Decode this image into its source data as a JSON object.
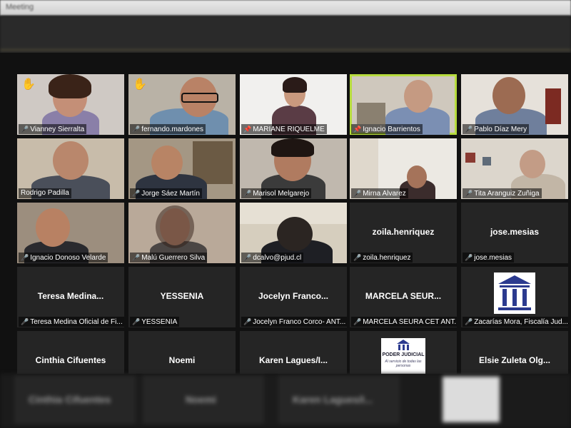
{
  "window": {
    "title": "Meeting"
  },
  "participants": [
    {
      "label": "Vianney Sierralta",
      "hand": true,
      "status": "muted"
    },
    {
      "label": "fernando.mardones",
      "hand": true,
      "status": "muted"
    },
    {
      "label": "MARIANE RIQUELME",
      "status": "pinned"
    },
    {
      "label": "Ignacio Barrientos",
      "status": "pinned",
      "active": true
    },
    {
      "label": "Pablo Díaz Mery",
      "status": "muted"
    },
    {
      "label": "Rodrigo Padilla",
      "status": "none"
    },
    {
      "label": "Jorge Sáez Martín",
      "status": "muted"
    },
    {
      "label": "Marisol Melgarejo",
      "status": "muted"
    },
    {
      "label": "Mirna Alvarez",
      "status": "muted"
    },
    {
      "label": "Tita Aranguiz Zuñiga",
      "status": "muted"
    },
    {
      "label": "Ignacio Donoso Velarde",
      "status": "muted"
    },
    {
      "label": "Malú Guerrero Silva",
      "status": "muted"
    },
    {
      "label": "dcalvo@pjud.cl",
      "status": "muted"
    },
    {
      "label": "zoila.henriquez",
      "display": "zoila.henriquez",
      "status": "muted"
    },
    {
      "label": "jose.mesias",
      "display": "jose.mesias",
      "status": "muted"
    },
    {
      "label": "Teresa Medina Oficial de Fi...",
      "display": "Teresa  Medina...",
      "status": "muted"
    },
    {
      "label": "YESSENIA",
      "display": "YESSENIA",
      "status": "muted"
    },
    {
      "label": "Jocelyn Franco Corco- ANT...",
      "display": "Jocelyn  Franco...",
      "status": "muted"
    },
    {
      "label": "MARCELA SEURA CET ANT...",
      "display": "MARCELA  SEUR...",
      "status": "muted"
    },
    {
      "label": "Zacarías Mora, Fiscalía Jud...",
      "status": "muted",
      "logo": "courthouse"
    },
    {
      "display": "Cinthia Cifuentes"
    },
    {
      "display": "Noemi"
    },
    {
      "display": "Karen  Lagues/I..."
    },
    {
      "logo": "poder-judicial",
      "logo_text": "PODER JUDICIAL",
      "logo_sub": "Al servicio de todas las personas"
    },
    {
      "display": "Elsie  Zuleta  Olg..."
    }
  ],
  "bottom_row": [
    "Cinthia Cifuentes",
    "Noemi",
    "Karen Lagues/I..."
  ],
  "colors": {
    "active_border": "#b7dc3e",
    "muted": "#e23b3b",
    "hand": "#f6c700"
  }
}
